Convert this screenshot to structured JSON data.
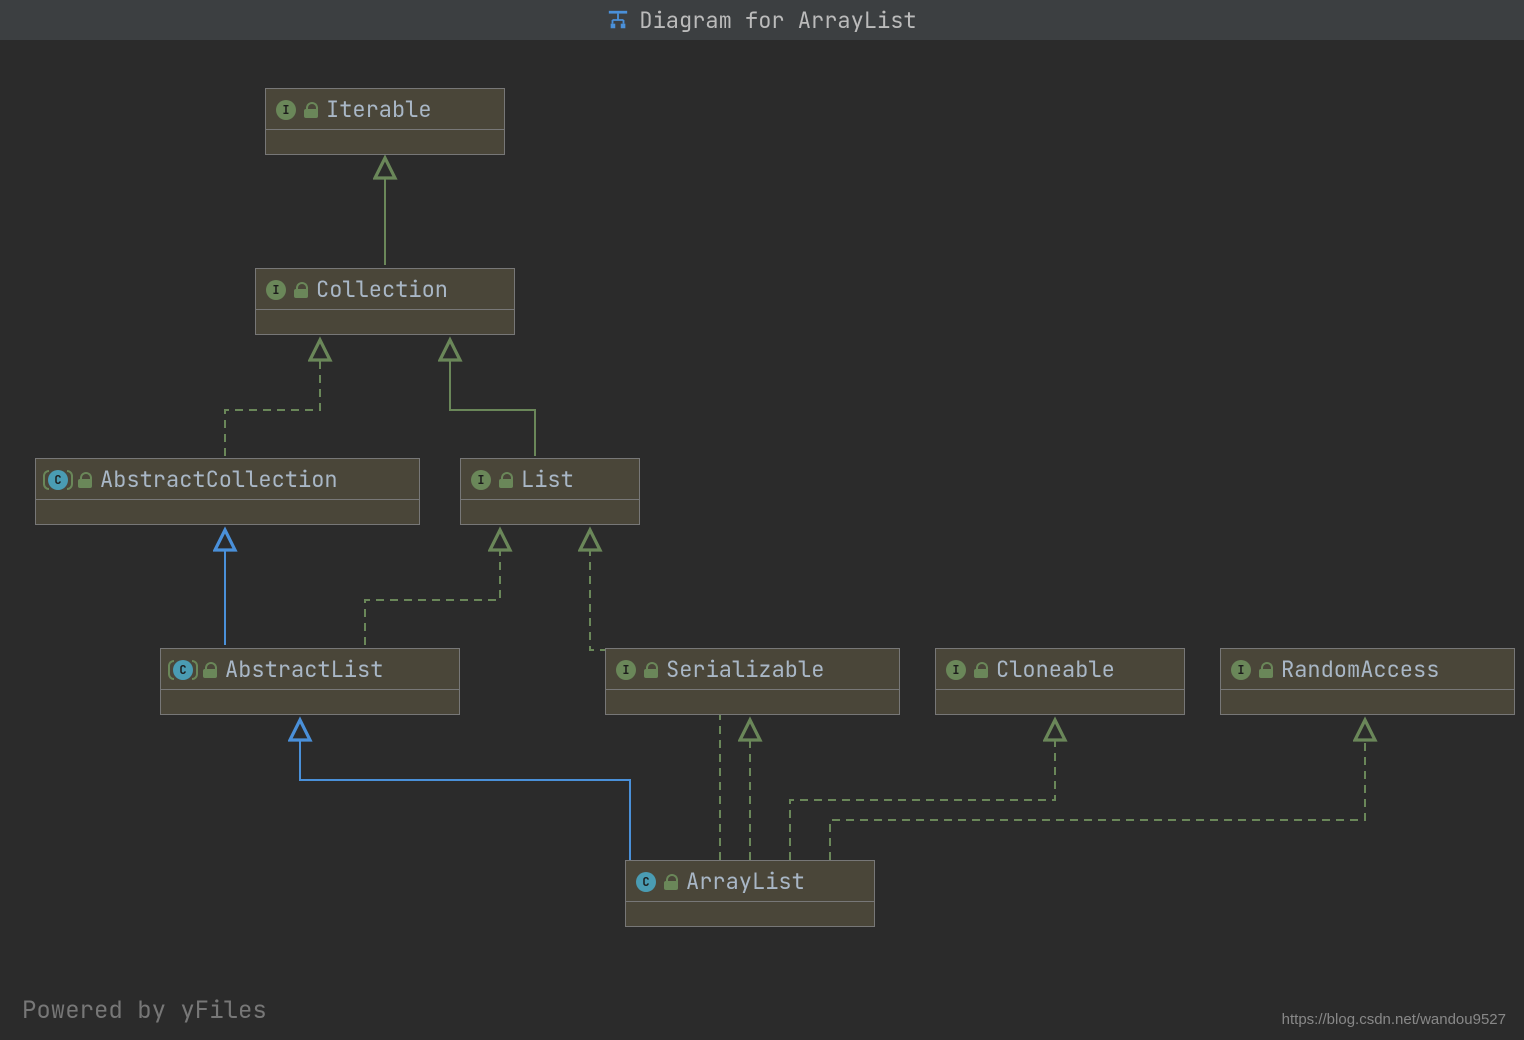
{
  "title": "Diagram for ArrayList",
  "footer_left": "Powered by yFiles",
  "footer_right": "https://blog.csdn.net/wandou9527",
  "badges": {
    "interface_letter": "I",
    "class_letter": "C"
  },
  "nodes": {
    "iterable": {
      "label": "Iterable",
      "kind": "interface"
    },
    "collection": {
      "label": "Collection",
      "kind": "interface"
    },
    "abstract_collection": {
      "label": "AbstractCollection",
      "kind": "abstract_class"
    },
    "list": {
      "label": "List",
      "kind": "interface"
    },
    "abstract_list": {
      "label": "AbstractList",
      "kind": "abstract_class"
    },
    "serializable": {
      "label": "Serializable",
      "kind": "interface"
    },
    "cloneable": {
      "label": "Cloneable",
      "kind": "interface"
    },
    "random_access": {
      "label": "RandomAccess",
      "kind": "interface"
    },
    "array_list": {
      "label": "ArrayList",
      "kind": "class"
    }
  },
  "edges": [
    {
      "from": "collection",
      "to": "iterable",
      "style": "implements"
    },
    {
      "from": "abstract_collection",
      "to": "collection",
      "style": "implements"
    },
    {
      "from": "list",
      "to": "collection",
      "style": "implements"
    },
    {
      "from": "abstract_list",
      "to": "abstract_collection",
      "style": "extends"
    },
    {
      "from": "abstract_list",
      "to": "list",
      "style": "implements"
    },
    {
      "from": "array_list",
      "to": "abstract_list",
      "style": "extends"
    },
    {
      "from": "array_list",
      "to": "list",
      "style": "implements"
    },
    {
      "from": "array_list",
      "to": "serializable",
      "style": "implements"
    },
    {
      "from": "array_list",
      "to": "cloneable",
      "style": "implements"
    },
    {
      "from": "array_list",
      "to": "random_access",
      "style": "implements"
    }
  ],
  "colors": {
    "extends": "#4a90d9",
    "implements": "#6a8759"
  }
}
